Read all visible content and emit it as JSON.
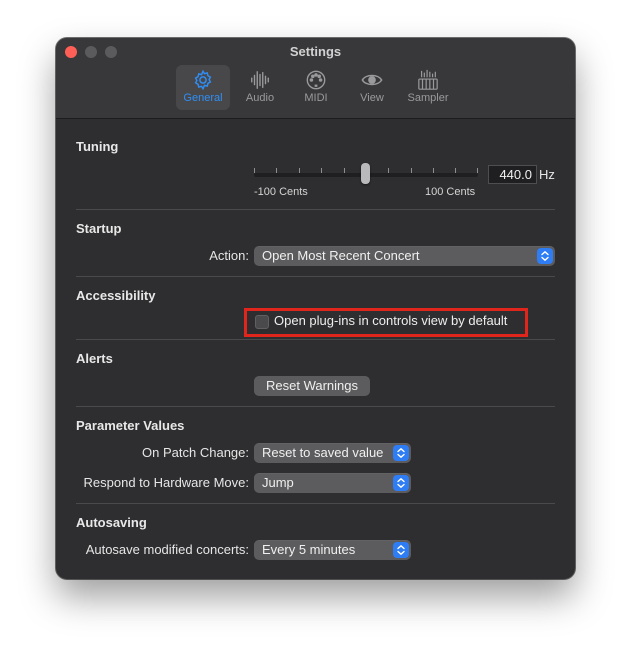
{
  "window": {
    "title": "Settings"
  },
  "toolbar": {
    "tabs": [
      {
        "label": "General",
        "icon": "gear-icon",
        "active": true
      },
      {
        "label": "Audio",
        "icon": "waveform-icon",
        "active": false
      },
      {
        "label": "MIDI",
        "icon": "midi-port-icon",
        "active": false
      },
      {
        "label": "View",
        "icon": "eye-icon",
        "active": false
      },
      {
        "label": "Sampler",
        "icon": "sampler-keyboard-icon",
        "active": false
      }
    ]
  },
  "tuning": {
    "title": "Tuning",
    "min_label": "-100 Cents",
    "max_label": "100 Cents",
    "slider_value_cents": 0,
    "value": "440.0",
    "unit": "Hz"
  },
  "startup": {
    "title": "Startup",
    "action_label": "Action:",
    "action_value": "Open Most Recent Concert"
  },
  "accessibility": {
    "title": "Accessibility",
    "checkbox_label": "Open plug-ins in controls view by default",
    "checked": false
  },
  "alerts": {
    "title": "Alerts",
    "reset_button": "Reset Warnings"
  },
  "parameter_values": {
    "title": "Parameter Values",
    "patch_change_label": "On Patch Change:",
    "patch_change_value": "Reset to saved value",
    "hardware_move_label": "Respond to Hardware Move:",
    "hardware_move_value": "Jump"
  },
  "autosaving": {
    "title": "Autosaving",
    "label": "Autosave modified concerts:",
    "value": "Every 5 minutes"
  },
  "colors": {
    "accent": "#2f8ef5",
    "highlight": "#e0261c",
    "window_bg": "#2e2e30"
  }
}
